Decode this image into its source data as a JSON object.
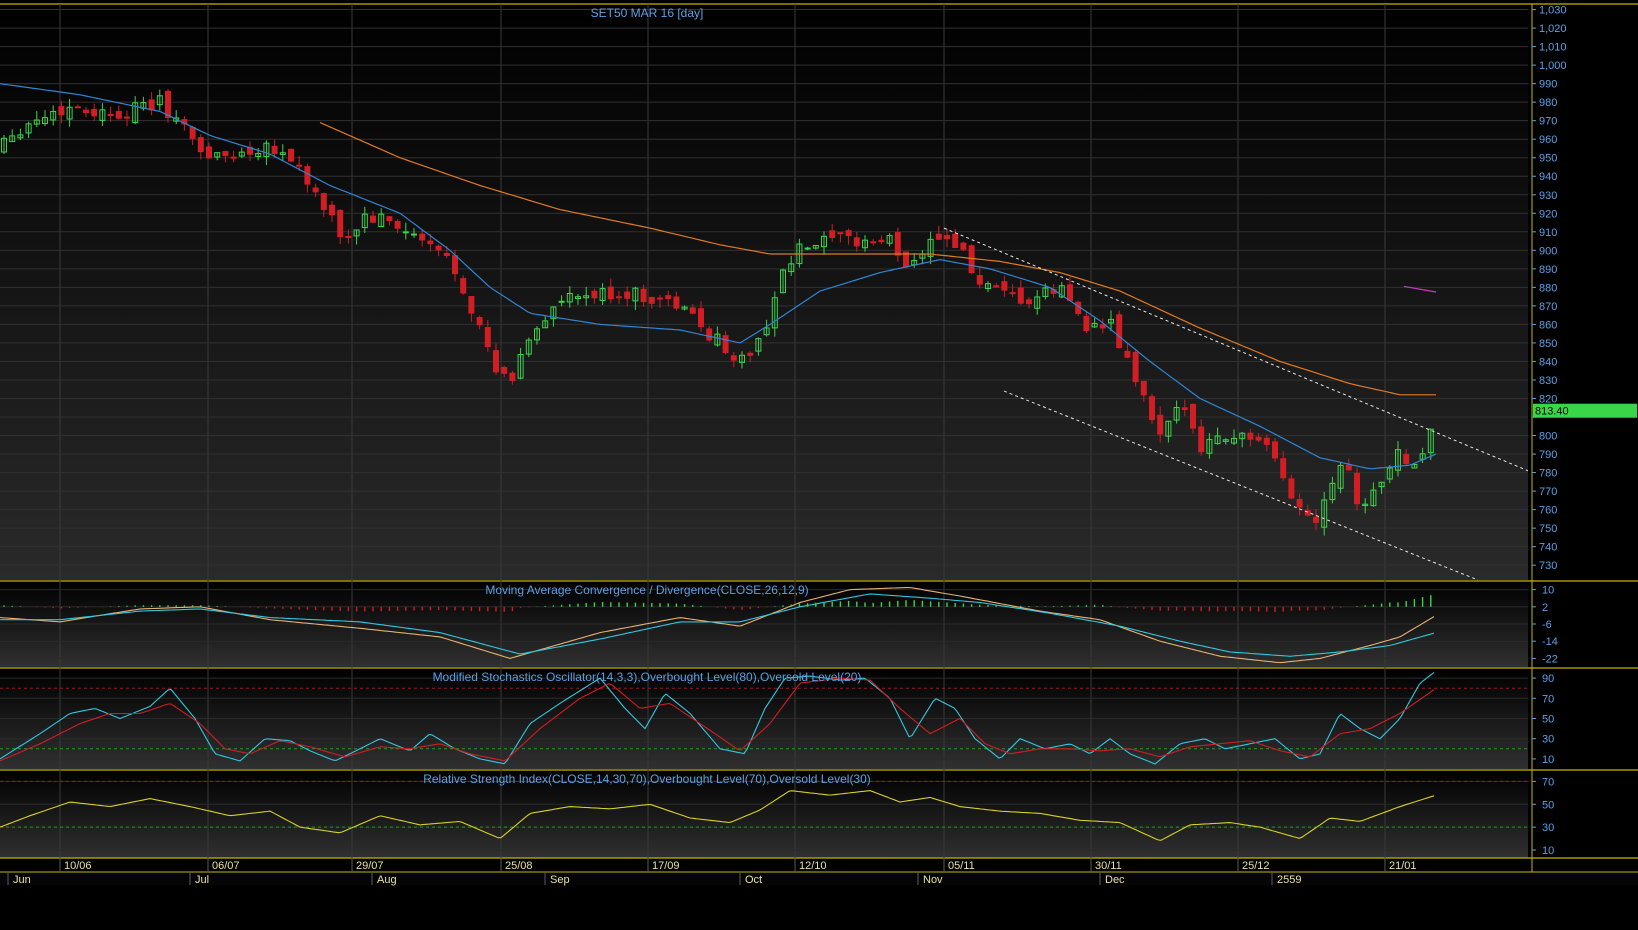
{
  "chart_data": [
    {
      "type": "candlestick",
      "title": "SET50 MAR 16   [day]",
      "ylim": [
        722,
        1033
      ],
      "yticks": [
        730,
        740,
        750,
        760,
        770,
        780,
        790,
        800,
        810,
        820,
        830,
        840,
        850,
        860,
        870,
        880,
        890,
        900,
        910,
        920,
        930,
        940,
        950,
        960,
        970,
        980,
        990,
        1000,
        1010,
        1020,
        1030
      ],
      "ytick_labels": [
        "730",
        "740",
        "750",
        "760",
        "770",
        "780",
        "790",
        "800",
        "",
        "820",
        "830",
        "840",
        "850",
        "860",
        "870",
        "880",
        "890",
        "900",
        "910",
        "920",
        "930",
        "940",
        "950",
        "960",
        "970",
        "980",
        "990",
        "1,000",
        "1,010",
        "1,020",
        "1,030"
      ],
      "last_price_label": "813.40",
      "last_price": 813.4,
      "x_date_labels": [
        "10/06",
        "06/07",
        "29/07",
        "25/08",
        "17/09",
        "12/10",
        "05/11",
        "30/11",
        "25/12",
        "21/01"
      ],
      "x_month_labels": [
        "Jun",
        "Jul",
        "Aug",
        "Sep",
        "Oct",
        "Nov",
        "Dec",
        "2559"
      ],
      "colors": {
        "up": "#3ad64a",
        "down": "#d01e24",
        "ma_fast": "#2e86d6",
        "ma_slow": "#e07a22",
        "trendline": "#e6e6e6",
        "axis": "#5aa0e6"
      }
    },
    {
      "type": "line",
      "title": "Moving Average Convergence / Divergence(CLOSE,26,12,9)",
      "ylim": [
        -26,
        14
      ],
      "yticks": [
        10,
        2,
        -6,
        -14,
        -22
      ],
      "ytick_labels": [
        "10",
        "2",
        "-6",
        "-14",
        "-22"
      ],
      "series": [
        {
          "color": "#e8b070",
          "anchors": [
            [
              0,
              -3
            ],
            [
              60,
              -5
            ],
            [
              140,
              1
            ],
            [
              200,
              2
            ],
            [
              270,
              -4
            ],
            [
              360,
              -8
            ],
            [
              440,
              -12
            ],
            [
              510,
              -22
            ],
            [
              600,
              -10
            ],
            [
              680,
              -3
            ],
            [
              740,
              -7
            ],
            [
              800,
              4
            ],
            [
              850,
              10
            ],
            [
              910,
              11
            ],
            [
              960,
              7
            ],
            [
              1040,
              0
            ],
            [
              1100,
              -4
            ],
            [
              1160,
              -14
            ],
            [
              1220,
              -21
            ],
            [
              1280,
              -24
            ],
            [
              1320,
              -22
            ],
            [
              1370,
              -16
            ],
            [
              1400,
              -12
            ],
            [
              1436,
              -2
            ]
          ]
        },
        {
          "color": "#30c8e0",
          "anchors": [
            [
              0,
              -4
            ],
            [
              60,
              -4
            ],
            [
              140,
              0
            ],
            [
              200,
              1
            ],
            [
              270,
              -3
            ],
            [
              360,
              -5
            ],
            [
              440,
              -10
            ],
            [
              520,
              -20
            ],
            [
              600,
              -13
            ],
            [
              680,
              -5
            ],
            [
              740,
              -5
            ],
            [
              800,
              2
            ],
            [
              870,
              8
            ],
            [
              930,
              6
            ],
            [
              980,
              4
            ],
            [
              1050,
              -1
            ],
            [
              1120,
              -7
            ],
            [
              1180,
              -14
            ],
            [
              1230,
              -19
            ],
            [
              1290,
              -21
            ],
            [
              1340,
              -19
            ],
            [
              1390,
              -16
            ],
            [
              1436,
              -10
            ]
          ]
        }
      ],
      "histogram_color_up": "#3ad64a",
      "histogram_color_down": "#d01e24"
    },
    {
      "type": "line",
      "title": "Modified Stochastics Oscillator(14,3,3),Overbought Level(80),Oversold Level(20)",
      "ylim": [
        0,
        100
      ],
      "yticks": [
        90,
        70,
        50,
        30,
        10
      ],
      "ytick_labels": [
        "90",
        "70",
        "50",
        "30",
        "10"
      ],
      "overbought": 80,
      "oversold": 20,
      "series": [
        {
          "color": "#30c8e0",
          "anchors": [
            [
              0,
              10
            ],
            [
              40,
              35
            ],
            [
              70,
              55
            ],
            [
              95,
              60
            ],
            [
              120,
              50
            ],
            [
              150,
              62
            ],
            [
              170,
              80
            ],
            [
              195,
              50
            ],
            [
              215,
              15
            ],
            [
              240,
              8
            ],
            [
              265,
              30
            ],
            [
              290,
              28
            ],
            [
              310,
              18
            ],
            [
              335,
              8
            ],
            [
              360,
              20
            ],
            [
              380,
              30
            ],
            [
              410,
              18
            ],
            [
              430,
              35
            ],
            [
              455,
              20
            ],
            [
              480,
              10
            ],
            [
              505,
              5
            ],
            [
              530,
              45
            ],
            [
              560,
              65
            ],
            [
              600,
              90
            ],
            [
              625,
              60
            ],
            [
              645,
              40
            ],
            [
              665,
              75
            ],
            [
              690,
              55
            ],
            [
              720,
              20
            ],
            [
              745,
              15
            ],
            [
              765,
              60
            ],
            [
              785,
              90
            ],
            [
              810,
              92
            ],
            [
              840,
              88
            ],
            [
              865,
              90
            ],
            [
              890,
              70
            ],
            [
              910,
              30
            ],
            [
              935,
              70
            ],
            [
              955,
              60
            ],
            [
              975,
              30
            ],
            [
              1000,
              10
            ],
            [
              1020,
              30
            ],
            [
              1045,
              20
            ],
            [
              1070,
              25
            ],
            [
              1090,
              15
            ],
            [
              1110,
              30
            ],
            [
              1130,
              15
            ],
            [
              1155,
              5
            ],
            [
              1180,
              25
            ],
            [
              1205,
              30
            ],
            [
              1225,
              20
            ],
            [
              1250,
              25
            ],
            [
              1275,
              30
            ],
            [
              1300,
              10
            ],
            [
              1320,
              15
            ],
            [
              1340,
              55
            ],
            [
              1360,
              40
            ],
            [
              1380,
              30
            ],
            [
              1400,
              50
            ],
            [
              1420,
              85
            ],
            [
              1436,
              97
            ]
          ]
        },
        {
          "color": "#d01e24",
          "anchors": [
            [
              0,
              8
            ],
            [
              40,
              25
            ],
            [
              80,
              45
            ],
            [
              110,
              55
            ],
            [
              140,
              55
            ],
            [
              170,
              65
            ],
            [
              200,
              45
            ],
            [
              225,
              20
            ],
            [
              250,
              15
            ],
            [
              280,
              28
            ],
            [
              310,
              22
            ],
            [
              345,
              12
            ],
            [
              380,
              22
            ],
            [
              410,
              20
            ],
            [
              440,
              25
            ],
            [
              470,
              15
            ],
            [
              505,
              8
            ],
            [
              540,
              40
            ],
            [
              580,
              70
            ],
            [
              610,
              85
            ],
            [
              640,
              60
            ],
            [
              670,
              65
            ],
            [
              700,
              45
            ],
            [
              740,
              18
            ],
            [
              770,
              45
            ],
            [
              800,
              85
            ],
            [
              840,
              90
            ],
            [
              870,
              88
            ],
            [
              900,
              60
            ],
            [
              930,
              35
            ],
            [
              960,
              50
            ],
            [
              985,
              25
            ],
            [
              1010,
              15
            ],
            [
              1040,
              20
            ],
            [
              1070,
              20
            ],
            [
              1100,
              18
            ],
            [
              1130,
              20
            ],
            [
              1160,
              12
            ],
            [
              1190,
              22
            ],
            [
              1220,
              25
            ],
            [
              1250,
              28
            ],
            [
              1280,
              18
            ],
            [
              1310,
              12
            ],
            [
              1340,
              35
            ],
            [
              1370,
              40
            ],
            [
              1400,
              55
            ],
            [
              1436,
              80
            ]
          ]
        }
      ]
    },
    {
      "type": "line",
      "title": "Relative Strength Index(CLOSE,14,30,70),Overbought Level(70),Oversold Level(30)",
      "ylim": [
        3,
        80
      ],
      "yticks": [
        70,
        50,
        30,
        10
      ],
      "ytick_labels": [
        "70",
        "50",
        "30",
        "10"
      ],
      "overbought": 70,
      "oversold": 30,
      "series": [
        {
          "color": "#d8d020",
          "anchors": [
            [
              0,
              30
            ],
            [
              30,
              40
            ],
            [
              70,
              52
            ],
            [
              110,
              48
            ],
            [
              150,
              55
            ],
            [
              190,
              48
            ],
            [
              230,
              40
            ],
            [
              270,
              44
            ],
            [
              300,
              30
            ],
            [
              340,
              25
            ],
            [
              380,
              40
            ],
            [
              420,
              32
            ],
            [
              460,
              35
            ],
            [
              500,
              20
            ],
            [
              530,
              42
            ],
            [
              570,
              48
            ],
            [
              610,
              46
            ],
            [
              650,
              50
            ],
            [
              690,
              38
            ],
            [
              730,
              34
            ],
            [
              760,
              45
            ],
            [
              790,
              62
            ],
            [
              830,
              58
            ],
            [
              870,
              62
            ],
            [
              900,
              52
            ],
            [
              930,
              56
            ],
            [
              960,
              48
            ],
            [
              1000,
              44
            ],
            [
              1040,
              42
            ],
            [
              1080,
              36
            ],
            [
              1120,
              34
            ],
            [
              1160,
              18
            ],
            [
              1190,
              32
            ],
            [
              1230,
              34
            ],
            [
              1260,
              30
            ],
            [
              1300,
              20
            ],
            [
              1330,
              38
            ],
            [
              1360,
              35
            ],
            [
              1400,
              48
            ],
            [
              1436,
              58
            ]
          ]
        }
      ]
    }
  ]
}
